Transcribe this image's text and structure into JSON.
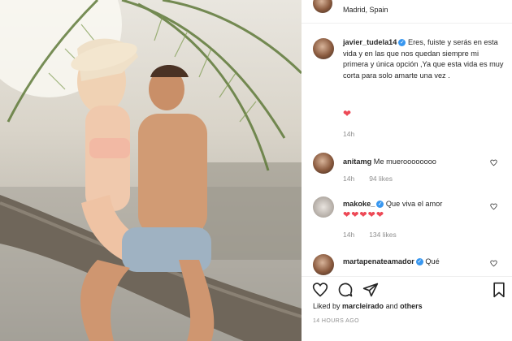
{
  "post": {
    "location": "Madrid, Spain",
    "caption": {
      "username": "javier_tudela14",
      "text": " Eres, fuiste y serás en esta vida y en las que nos quedan siempre mi primera y única opción ,Ya que esta vida es muy corta para solo amarte una vez .",
      "emoji": "❤",
      "age": "14h"
    },
    "comments": [
      {
        "username": "anitamg",
        "text": "Me mueroooooooo",
        "age": "14h",
        "likes": "94 likes"
      },
      {
        "username": "makoke_",
        "text": "Que viva el amor",
        "hearts": "❤❤❤❤❤",
        "age": "14h",
        "likes": "134 likes"
      },
      {
        "username": "martapenateamador",
        "text": "Qué"
      }
    ],
    "liked_by": {
      "prefix": "Liked by ",
      "user": "marcleirado",
      "mid": " and ",
      "others": "others"
    },
    "timestamp": "14 HOURS AGO"
  },
  "colors": {
    "verified": "#3897f0",
    "heart": "#ed4956",
    "muted": "#8e8e8e"
  }
}
